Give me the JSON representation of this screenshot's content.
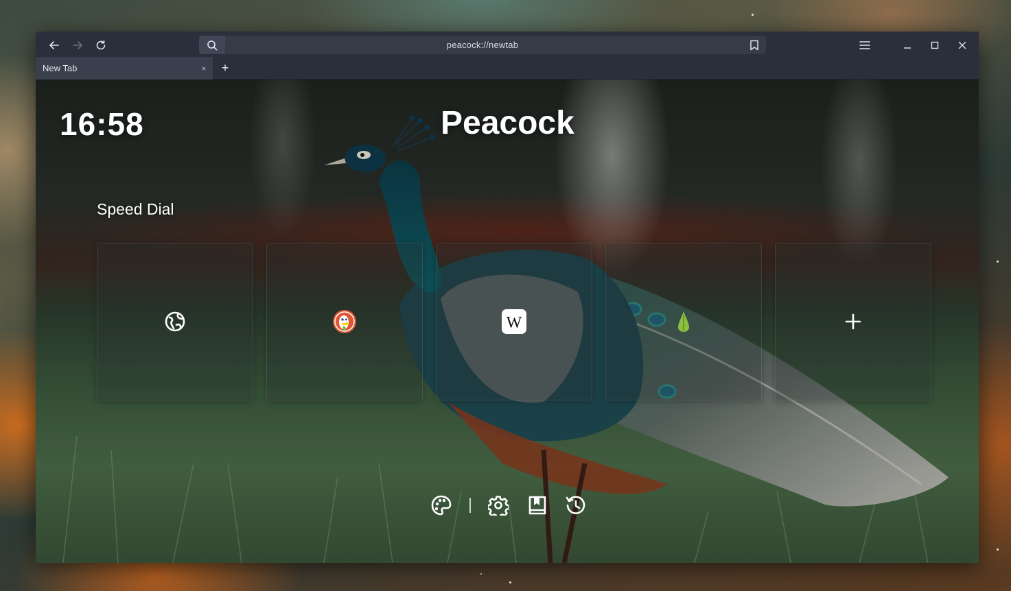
{
  "browser": {
    "url": "peacock://newtab",
    "tab_title": "New Tab",
    "tab_close": "×",
    "new_tab": "+"
  },
  "newtab": {
    "clock": "16:58",
    "brand": "Peacock",
    "speed_dial_heading": "Speed Dial",
    "tiles": [
      {
        "icon": "globe-icon"
      },
      {
        "icon": "duckduckgo-icon"
      },
      {
        "icon": "wikipedia-icon"
      },
      {
        "icon": "ecosia-tree-icon"
      },
      {
        "icon": "plus-icon"
      }
    ],
    "bottom_actions": [
      "palette-icon",
      "gear-icon",
      "bookmarks-icon",
      "history-icon"
    ]
  },
  "colors": {
    "titlebar": "#2b2f3b",
    "urlbar": "#363b48",
    "text": "#ffffff"
  }
}
